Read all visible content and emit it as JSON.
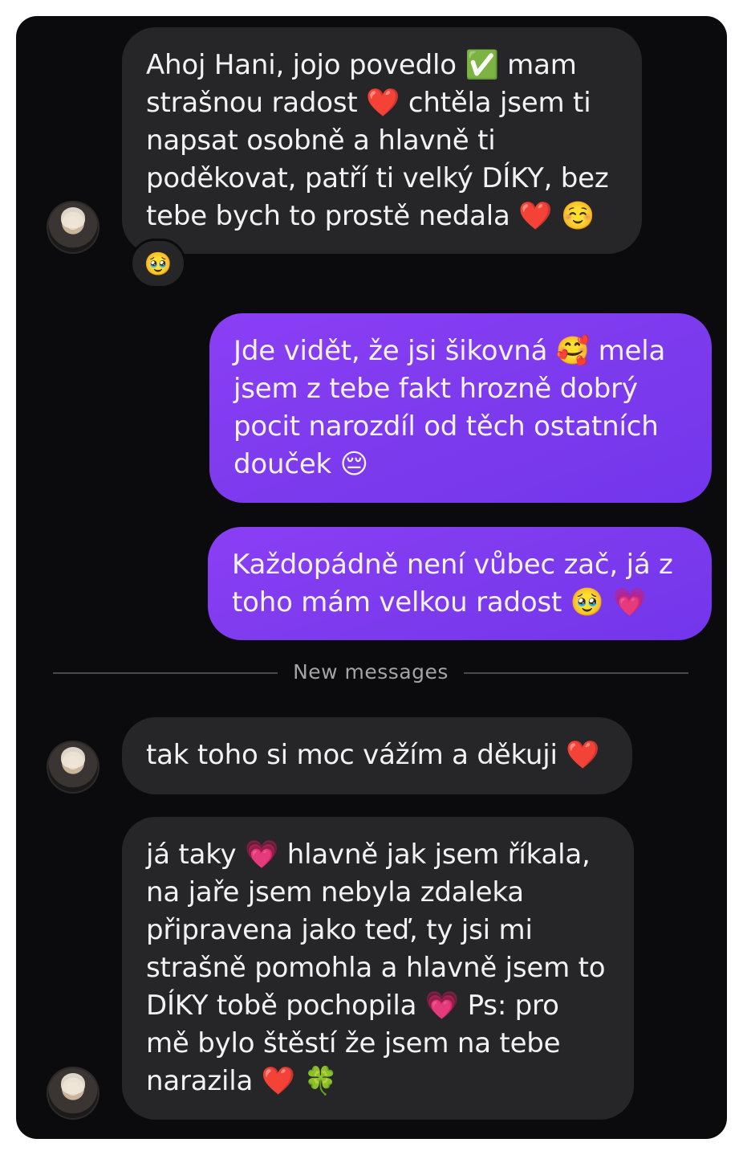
{
  "colors": {
    "background": "#0b0b0d",
    "incoming_bubble": "#262628",
    "outgoing_bubble": "#7c3aed",
    "text": "#f2f2f4",
    "divider_text": "#a3a3a8"
  },
  "messages": [
    {
      "direction": "incoming",
      "text": "Ahoj Hani, jojo povedlo ✅ mam\nstrašnou radost ❤️ chtěla jsem ti\nnapsat osobně a hlavně ti\npoděkovat, patří ti velký DÍKY, bez\ntebe bych to prostě nedala ❤️ ☺️",
      "reaction": "🥹"
    },
    {
      "direction": "outgoing",
      "text": "Jde vidět, že jsi šikovná 🥰 mela\njsem z tebe fakt hrozně dobrý\npocit narozdíl od těch ostatních\ndouček 😔"
    },
    {
      "direction": "outgoing",
      "text": "Každopádně není vůbec zač, já z\ntoho mám velkou radost 🥹 💗"
    },
    {
      "direction": "incoming",
      "text": "tak toho si moc vážím a děkuji ❤️"
    },
    {
      "direction": "incoming",
      "text": "já taky 💗 hlavně jak jsem říkala,\nna jaře jsem nebyla zdaleka\npřipravena jako teď, ty jsi mi\nstrašně pomohla a hlavně jsem to\nDÍKY tobě pochopila 💗 Ps: pro\nmě bylo štěstí že jsem na tebe\nnarazila ❤️ 🍀"
    }
  ],
  "divider": {
    "label": "New messages"
  }
}
